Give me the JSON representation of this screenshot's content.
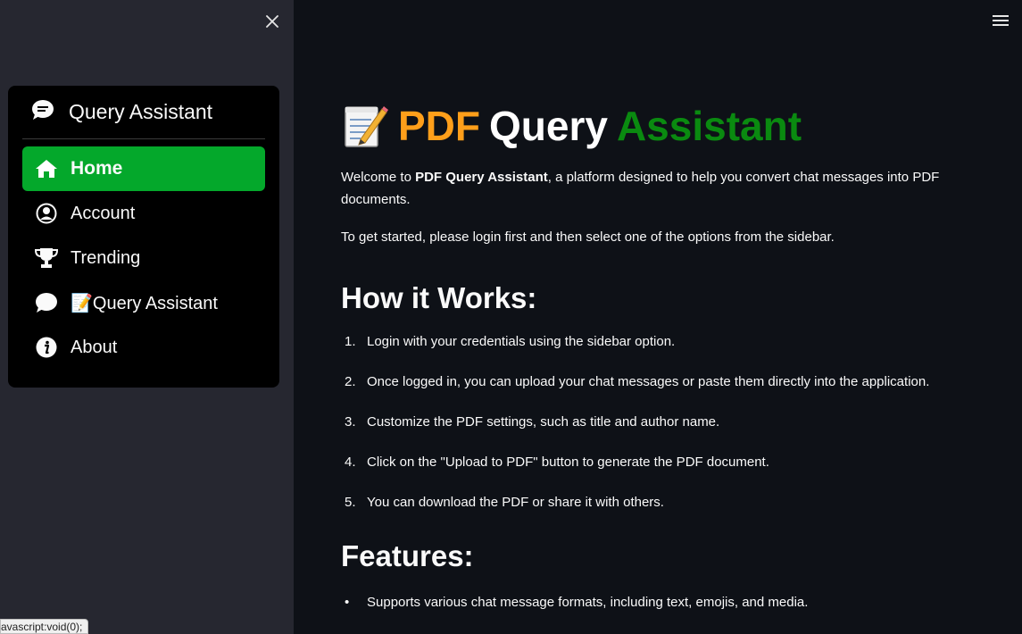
{
  "sidebar": {
    "menu_title": "Query Assistant",
    "items": [
      {
        "label": "Home",
        "icon": "house-icon"
      },
      {
        "label": "Account",
        "icon": "person-circle-icon"
      },
      {
        "label": "Trending",
        "icon": "trophy-icon"
      },
      {
        "label": "📝Query Assistant",
        "icon": "chat-bubble-icon"
      },
      {
        "label": "About",
        "icon": "info-icon"
      }
    ],
    "active_item": "Home",
    "status_link": "avascript:void(0);"
  },
  "main": {
    "title": {
      "emoji": "📝",
      "part1": "PDF",
      "part2": "Query",
      "part3": "Assistant"
    },
    "intro_prefix": "Welcome to ",
    "intro_bold": "PDF Query Assistant",
    "intro_suffix": ", a platform designed to help you convert chat messages into PDF documents.",
    "get_started": "To get started, please login first and then select one of the options from the sidebar.",
    "how_heading": "How it Works:",
    "steps": [
      {
        "num": "1.",
        "text": "Login with your credentials using the sidebar option."
      },
      {
        "num": "2.",
        "text": "Once logged in, you can upload your chat messages or paste them directly into the application."
      },
      {
        "num": "3.",
        "text": "Customize the PDF settings, such as title and author name."
      },
      {
        "num": "4.",
        "text": "Click on the \"Upload to PDF\" button to generate the PDF document."
      },
      {
        "num": "5.",
        "text": "You can download the PDF or share it with others."
      }
    ],
    "features_heading": "Features:",
    "features": [
      {
        "bullet": "•",
        "text": "Supports various chat message formats, including text, emojis, and media."
      }
    ]
  },
  "colors": {
    "background": "#0e1117",
    "sidebar": "#262730",
    "active": "#04a82b",
    "pdf": "#ff9f1a",
    "assistant": "#0a8a10"
  }
}
